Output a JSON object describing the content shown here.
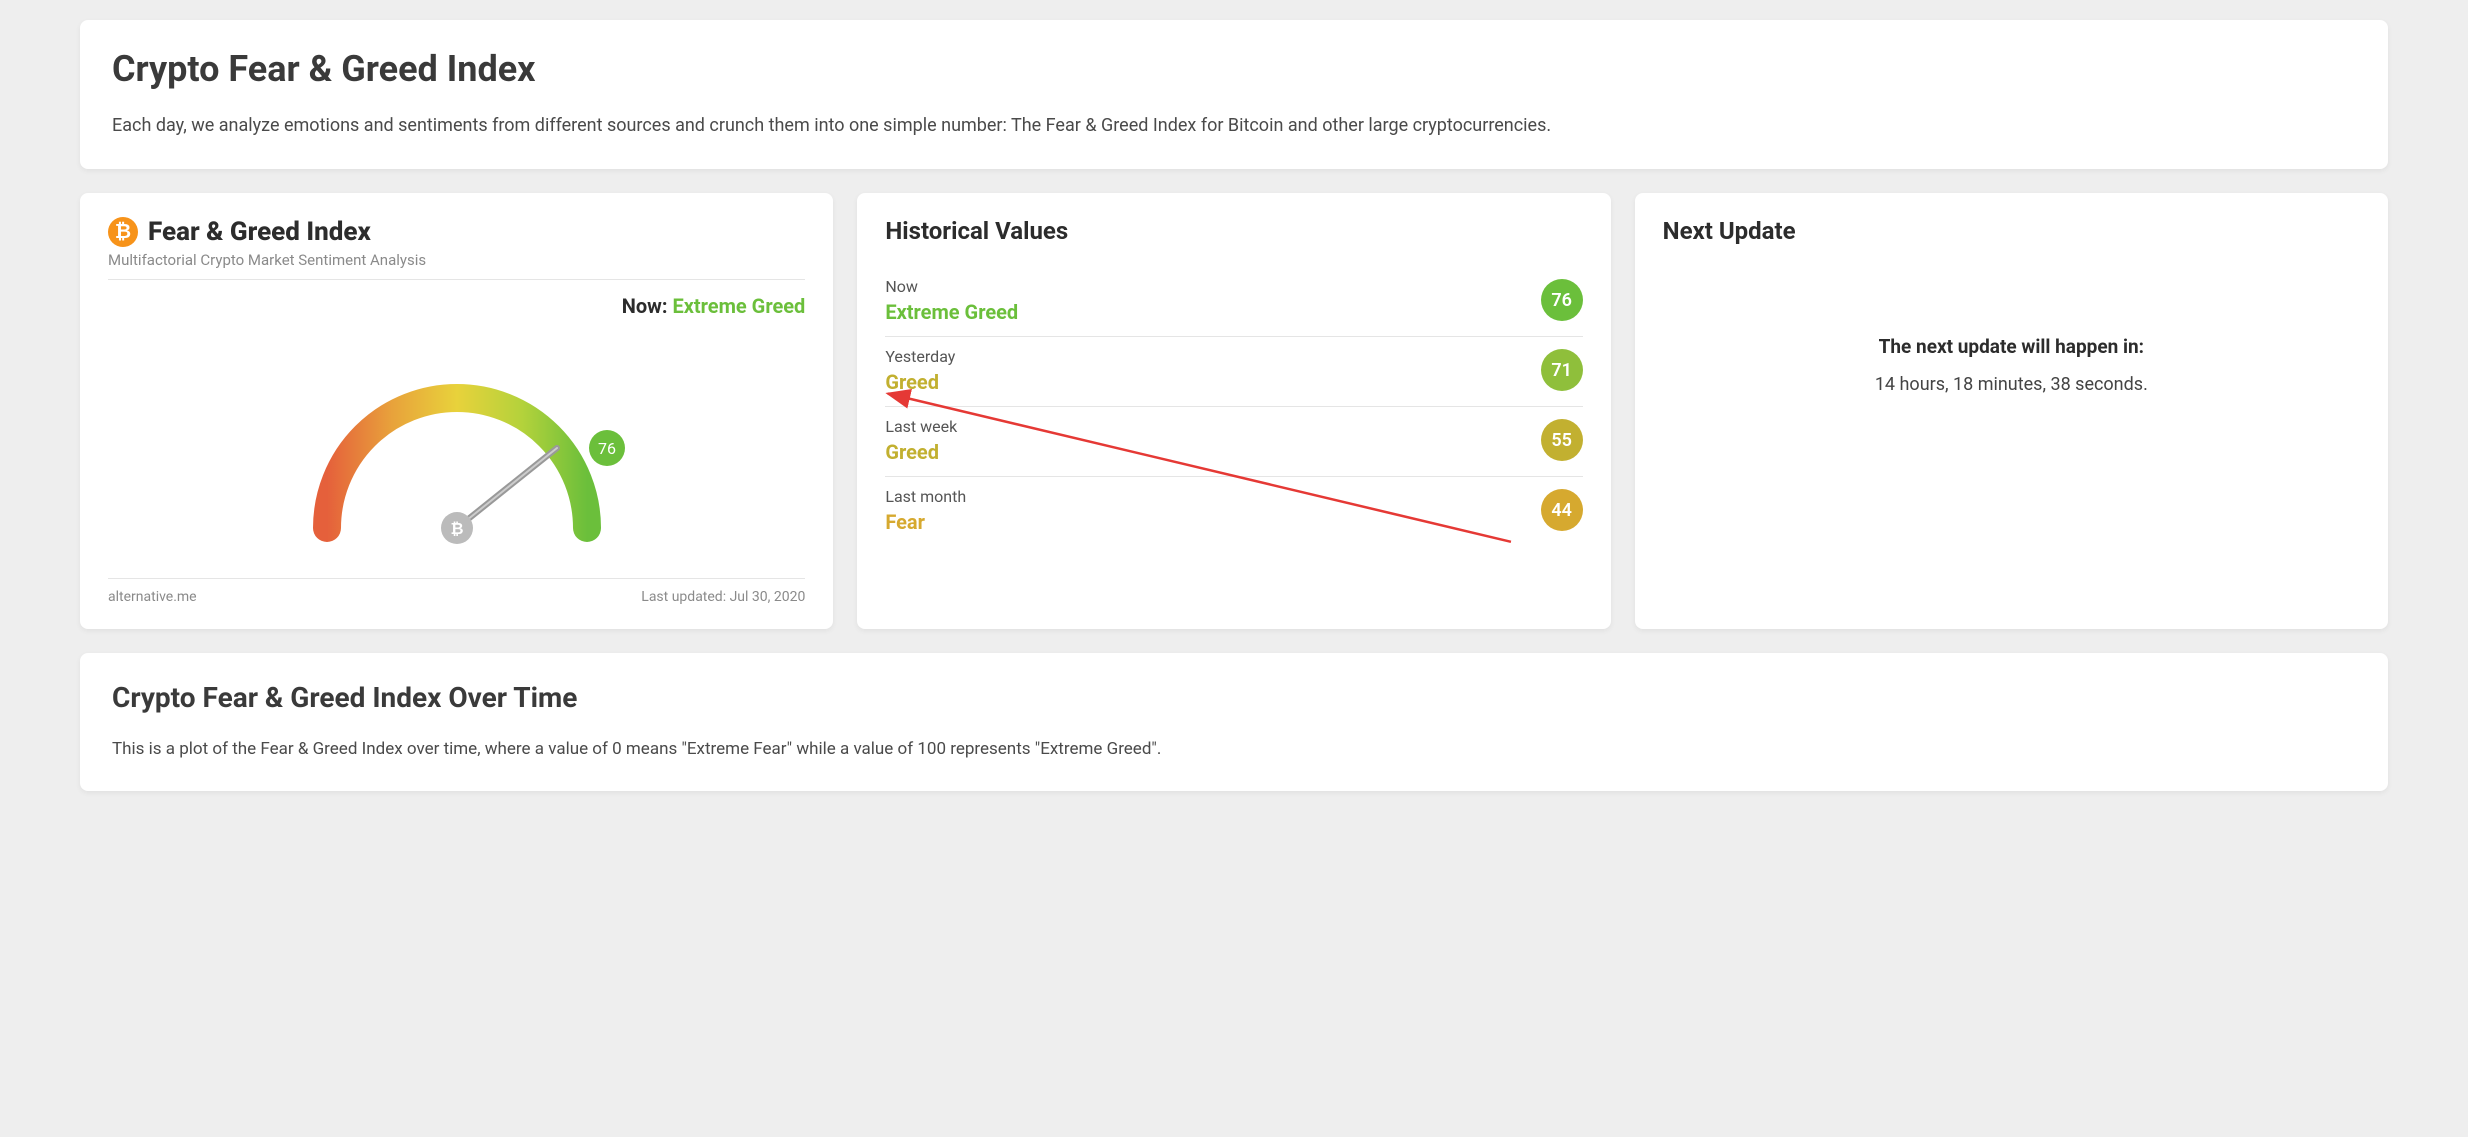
{
  "header": {
    "title": "Crypto Fear & Greed Index",
    "description": "Each day, we analyze emotions and sentiments from different sources and crunch them into one simple number: The Fear & Greed Index for Bitcoin and other large cryptocurrencies."
  },
  "gauge": {
    "title": "Fear & Greed Index",
    "subtitle": "Multifactorial Crypto Market Sentiment Analysis",
    "now_label": "Now:",
    "now_sentiment": "Extreme Greed",
    "value": "76",
    "source": "alternative.me",
    "last_updated": "Last updated: Jul 30, 2020"
  },
  "historical": {
    "title": "Historical Values",
    "rows": [
      {
        "label": "Now",
        "sentiment": "Extreme Greed",
        "value": "76",
        "color": "#6bbf3b",
        "text_color": "#6bbf3b"
      },
      {
        "label": "Yesterday",
        "sentiment": "Greed",
        "value": "71",
        "color": "#8fbf3b",
        "text_color": "#c2b030"
      },
      {
        "label": "Last week",
        "sentiment": "Greed",
        "value": "55",
        "color": "#c2b030",
        "text_color": "#c2b030"
      },
      {
        "label": "Last month",
        "sentiment": "Fear",
        "value": "44",
        "color": "#d6a92f",
        "text_color": "#d6a92f"
      }
    ]
  },
  "next_update": {
    "title": "Next Update",
    "line1": "The next update will happen in:",
    "line2": "14 hours, 18 minutes, 38 seconds."
  },
  "over_time": {
    "title": "Crypto Fear & Greed Index Over Time",
    "description": "This is a plot of the Fear & Greed Index over time, where a value of 0 means \"Extreme Fear\" while a value of 100 represents \"Extreme Greed\"."
  },
  "chart_data": {
    "type": "gauge",
    "title": "Fear & Greed Index",
    "value": 76,
    "min": 0,
    "max": 100,
    "label": "Extreme Greed",
    "scale_labels": {
      "0": "Extreme Fear",
      "100": "Extreme Greed"
    },
    "historical_series": {
      "categories": [
        "Now",
        "Yesterday",
        "Last week",
        "Last month"
      ],
      "values": [
        76,
        71,
        55,
        44
      ],
      "sentiments": [
        "Extreme Greed",
        "Greed",
        "Greed",
        "Fear"
      ]
    }
  }
}
